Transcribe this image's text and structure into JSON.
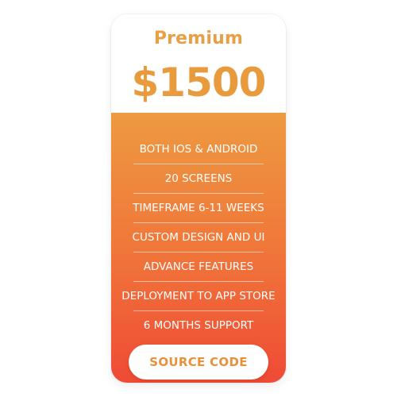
{
  "plan": {
    "name": "Premium",
    "price": "$1500"
  },
  "features": [
    "BOTH IOS & ANDROID",
    "20 SCREENS",
    "TIMEFRAME 6-11 WEEKS",
    "CUSTOM DESIGN AND UI",
    "ADVANCE FEATURES",
    "DEPLOYMENT TO APP STORE",
    "6 MONTHS SUPPORT"
  ],
  "cta": {
    "label": "SOURCE CODE"
  },
  "colors": {
    "accent": "#e8a046",
    "gradient_top": "#ed9a40",
    "gradient_bottom": "#ef4a35",
    "feature_text": "#ffffff"
  }
}
